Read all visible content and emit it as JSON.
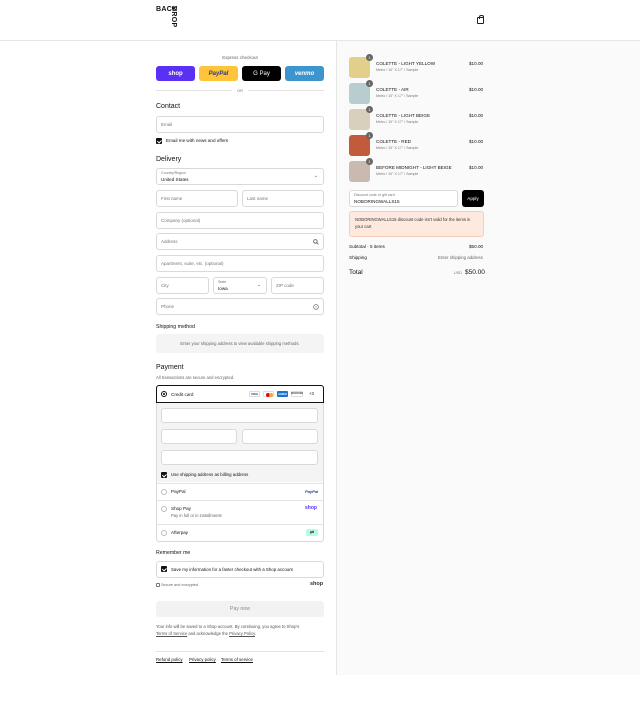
{
  "brand": {
    "logo_line1": "BACK",
    "logo_line2": "DROP"
  },
  "express": {
    "title": "Express checkout",
    "buttons": [
      "shop",
      "PayPal",
      "G Pay",
      "venmo"
    ],
    "or": "OR"
  },
  "contact": {
    "title": "Contact",
    "email_placeholder": "Email",
    "newsletter_label": "Email me with news and offers"
  },
  "delivery": {
    "title": "Delivery",
    "country_label": "Country/Region",
    "country_value": "United States",
    "first_name": "First name",
    "last_name": "Last name",
    "company": "Company (optional)",
    "address": "Address",
    "apartment": "Apartment, suite, etc. (optional)",
    "city": "City",
    "state_label": "State",
    "state_value": "Iowa",
    "zip": "ZIP code",
    "phone": "Phone"
  },
  "shipping_method": {
    "title": "Shipping method",
    "message": "Enter your shipping address to view available shipping methods."
  },
  "payment": {
    "title": "Payment",
    "subtitle": "All transactions are secure and encrypted.",
    "credit_card_label": "Credit card",
    "card_logos": [
      "VISA",
      "MC",
      "AMEX",
      "DISCOVER"
    ],
    "more_cards": "+3",
    "billing_same_label": "Use shipping address as billing address",
    "paypal_label": "PayPal",
    "paypal_logo": "PayPal",
    "shoppay_label": "Shop Pay",
    "shoppay_sub": "Pay in full or in installments",
    "shoppay_logo": "shop",
    "afterpay_label": "Afterpay"
  },
  "remember": {
    "title": "Remember me",
    "save_label": "Save my information for a faster checkout with a Shop account",
    "secure_label": "Secure and encrypted",
    "shop_logo": "shop"
  },
  "pay_button": "Pay now",
  "legal": {
    "text1": "Your info will be saved to a Shop account. By continuing, you agree to Shop's",
    "terms": "Terms of Service",
    "text2": "and acknowledge the",
    "privacy": "Privacy Policy",
    "text3": "."
  },
  "footer_links": [
    "Refund policy",
    "Privacy policy",
    "Terms of service"
  ],
  "cart": {
    "items": [
      {
        "name": "COLETTE - LIGHT YELLOW",
        "sub": "Metro / 10\" X 17\" / Sample",
        "price": "$10.00",
        "qty": "1",
        "color": "#e3cf8c"
      },
      {
        "name": "COLETTE - AIR",
        "sub": "Metro / 10\" X 17\" / Sample",
        "price": "$10.00",
        "qty": "1",
        "color": "#b8cdd0"
      },
      {
        "name": "COLETTE - LIGHT BEIGE",
        "sub": "Metro / 10\" X 17\" / Sample",
        "price": "$10.00",
        "qty": "1",
        "color": "#d8d0bd"
      },
      {
        "name": "COLETTE - RED",
        "sub": "Metro / 10\" X 17\" / Sample",
        "price": "$10.00",
        "qty": "1",
        "color": "#c25a3c"
      },
      {
        "name": "BEFORE MIDNIGHT - LIGHT BEIGE",
        "sub": "Metro / 10\" X 17\" / Sample",
        "price": "$10.00",
        "qty": "1",
        "color": "#c9b9ae"
      }
    ],
    "discount_label": "Discount code or gift card",
    "discount_value": "NOBORINGWALLS15",
    "apply": "Apply",
    "error": "NOBORINGWALLS15 discount code isn't valid for the items in your cart",
    "subtotal_label": "Subtotal · 5 items",
    "subtotal_value": "$50.00",
    "shipping_label": "Shipping",
    "shipping_value": "Enter shipping address",
    "total_label": "Total",
    "currency": "USD",
    "total_value": "$50.00"
  }
}
